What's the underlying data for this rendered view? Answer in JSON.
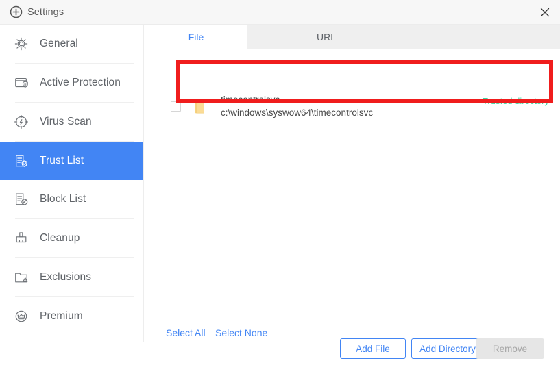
{
  "window": {
    "title": "Settings",
    "app_icon": "circle-plus-icon",
    "close_label": "✕"
  },
  "sidebar": {
    "items": [
      {
        "label": "General",
        "icon": "gear-icon",
        "active": false
      },
      {
        "label": "Active Protection",
        "icon": "shield-window-icon",
        "active": false
      },
      {
        "label": "Virus Scan",
        "icon": "scan-target-icon",
        "active": false
      },
      {
        "label": "Trust List",
        "icon": "document-check-icon",
        "active": true
      },
      {
        "label": "Block List",
        "icon": "document-block-icon",
        "active": false
      },
      {
        "label": "Cleanup",
        "icon": "broom-icon",
        "active": false
      },
      {
        "label": "Exclusions",
        "icon": "folder-warning-icon",
        "active": false
      },
      {
        "label": "Premium",
        "icon": "crown-circle-icon",
        "active": false
      }
    ]
  },
  "main": {
    "tabs": [
      {
        "label": "File",
        "active": true
      },
      {
        "label": "URL",
        "active": false
      }
    ],
    "rows": [
      {
        "checked": false,
        "icon": "folder-icon",
        "name": "timecontrolsvc",
        "path": "c:\\windows\\syswow64\\timecontrolsvc",
        "status": "Trusted directory"
      }
    ]
  },
  "footer": {
    "select_all": "Select All",
    "select_none": "Select None",
    "add_file": "Add File",
    "add_directory": "Add Directory",
    "remove": "Remove"
  },
  "colors": {
    "accent_blue": "#4285f4",
    "status_green": "#3fd6a3",
    "highlight_red": "#f01d1d",
    "disabled_gray": "#e6e6e6",
    "tab_inactive_bg": "#efefef",
    "titlebar_bg": "#f7f7f7"
  }
}
